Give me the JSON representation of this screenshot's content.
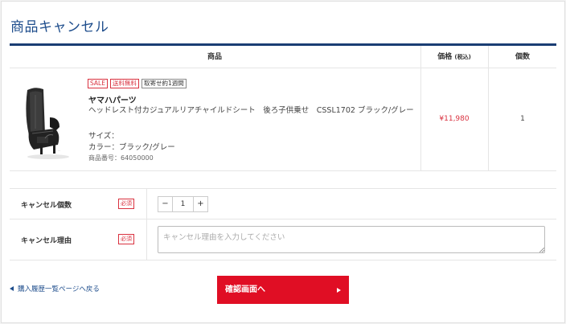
{
  "page": {
    "title": "商品キャンセル"
  },
  "table": {
    "headers": {
      "product": "商品",
      "price": "価格",
      "price_note": "(税込)",
      "quantity": "個数"
    },
    "item": {
      "badges": [
        "SALE",
        "送料無料",
        "取寄せ約1週間"
      ],
      "brand": "ヤマハパーツ",
      "name": "ヘッドレスト付カジュアルリアチャイルドシート　後ろ子供乗せ　CSSL1702 ブラック/グレー",
      "size": "サイズ：",
      "color": "カラー：ブラック/グレー",
      "code": "商品番号：64050000",
      "price": "¥11,980",
      "quantity": "1"
    }
  },
  "form": {
    "cancel_qty": {
      "label": "キャンセル個数",
      "required": "必須",
      "minus": "−",
      "value": "1",
      "plus": "+"
    },
    "cancel_reason": {
      "label": "キャンセル理由",
      "required": "必須",
      "placeholder": "キャンセル理由を入力してください"
    }
  },
  "footer": {
    "back_label": "購入履歴一覧ページへ戻る",
    "confirm_label": "確認画面へ"
  },
  "colors": {
    "accent_blue": "#1a3d73",
    "sale_red": "#d9313f",
    "button_red": "#e00e24"
  },
  "icons": {
    "back": "triangle-left-icon",
    "confirm": "triangle-right-icon"
  }
}
